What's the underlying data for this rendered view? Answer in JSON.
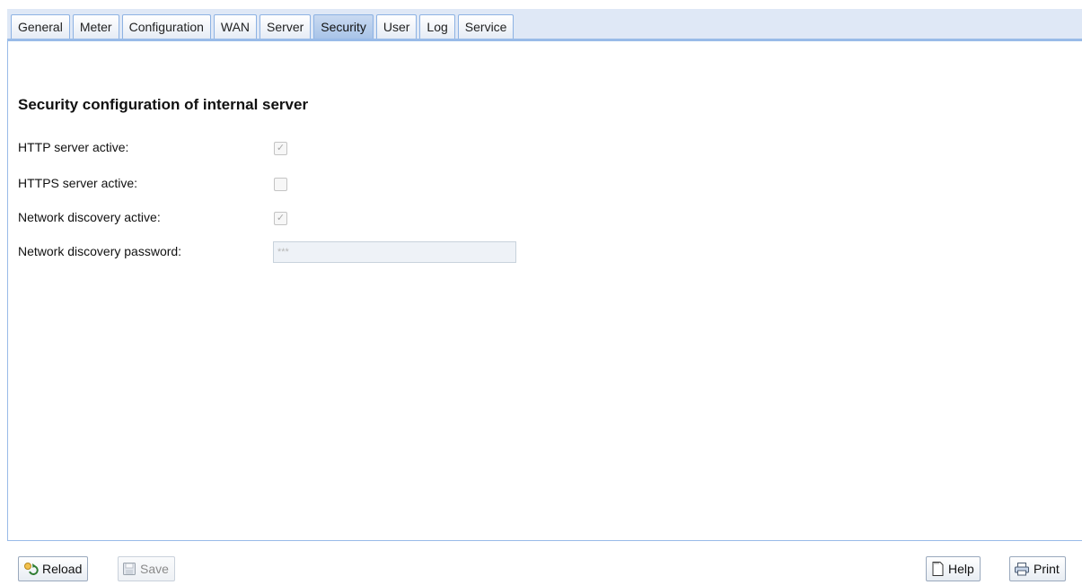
{
  "tabs": [
    {
      "label": "General",
      "active": false
    },
    {
      "label": "Meter",
      "active": false
    },
    {
      "label": "Configuration",
      "active": false
    },
    {
      "label": "WAN",
      "active": false
    },
    {
      "label": "Server",
      "active": false
    },
    {
      "label": "Security",
      "active": true
    },
    {
      "label": "User",
      "active": false
    },
    {
      "label": "Log",
      "active": false
    },
    {
      "label": "Service",
      "active": false
    }
  ],
  "panel": {
    "title": "Security configuration of internal server",
    "fields": {
      "http": {
        "label": "HTTP server active:",
        "checked": true,
        "disabled": true
      },
      "https": {
        "label": "HTTPS server active:",
        "checked": false,
        "disabled": true
      },
      "discovery": {
        "label": "Network discovery active:",
        "checked": true,
        "disabled": true
      },
      "password": {
        "label": "Network discovery password:",
        "value": "***"
      }
    }
  },
  "toolbar": {
    "reload_label": "Reload",
    "save_label": "Save",
    "help_label": "Help",
    "print_label": "Print"
  },
  "icons": {
    "reload": "reload-icon",
    "save": "save-icon",
    "help": "help-icon",
    "print": "print-icon",
    "check": "✓"
  },
  "colors": {
    "tab_strip": "#dfe8f6",
    "tab_border": "#99bbe8",
    "active_tab": "#a9c4e8"
  }
}
